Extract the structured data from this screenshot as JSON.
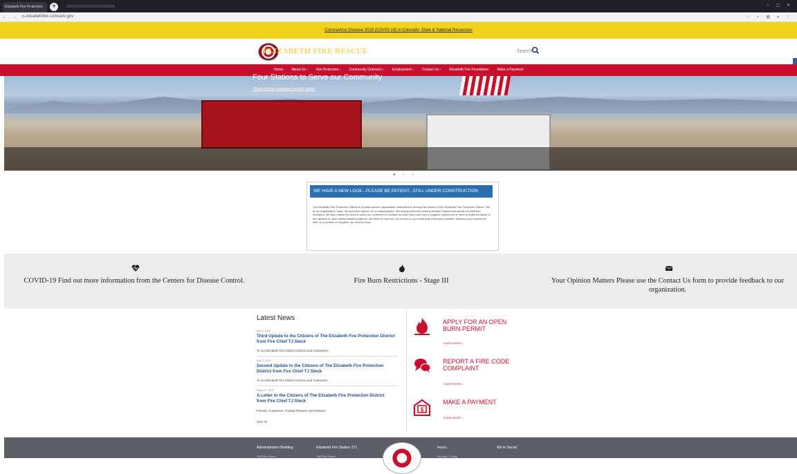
{
  "browser": {
    "tab_title": "Elizabeth Fire Protection",
    "url": "elizabethfire.colorado.gov"
  },
  "banner": {
    "text": "Coronavirus Disease 2019 (COVID-19) in Colorado: State & National Resources"
  },
  "header": {
    "search_label": "Search"
  },
  "nav": {
    "items": [
      {
        "label": "Home"
      },
      {
        "label": "About Us"
      },
      {
        "label": "Fire Protection"
      },
      {
        "label": "Community Outreach"
      },
      {
        "label": "Employment"
      },
      {
        "label": "Contact Us"
      },
      {
        "label": "Elizabeth Fire Foundation"
      },
      {
        "label": "Make a Payment"
      }
    ],
    "separator": "›"
  },
  "hero": {
    "truck_text": "ELIZABETH FIRE RESCUE",
    "title": "Four Stations to Serve our Community",
    "subtitle": "Check out the equipment at each station"
  },
  "notice": {
    "heading": "WE HAVE A NEW LOOK...PLEASE BE PATIENT...STILL UNDER CONSTRUCTION",
    "body": "The Elizabeth Fire Protection District is a public service organization dedicated to serving the citizens of the Elizabeth Fire Protection District. We, as an organization, value the input and opinion of our stakeholders. We always welcome hearing positive experiences about our staff and members. We also realize the need to allow our customers to contact us when they have had a negative experience or need to make us aware of fire hazards or other safety-related problems. We strive to improve our service to our community whenever possible. Whether your experience with us is positive or negative, we want to know."
  },
  "features": [
    {
      "icon": "heartbeat-icon",
      "text": "COVID-19 Find out more information from the Centers for Disease Control."
    },
    {
      "icon": "fire-icon",
      "text": "Fire Burn Restrictions - Stage III"
    },
    {
      "icon": "envelope-icon",
      "text": "Your Opinion Matters Please use the Contact Us form to provide feedback to our organization."
    }
  ],
  "news": {
    "title": "Latest News",
    "items": [
      {
        "date": "April 9, 2020",
        "headline": "Third Update to the Citizens of The Elizabeth Fire Protection District from Fire Chief TJ Steck",
        "excerpt": "To our Elizabeth Fire District Citizens and Customers,"
      },
      {
        "date": "April 3, 2020",
        "headline": "Second Update to the Citizens of The Elizabeth Fire Protection District from Fire Chief TJ Steck",
        "excerpt": "To our Elizabeth Fire District Citizens and Customers,"
      },
      {
        "date": "March 27, 2020",
        "headline": "A Letter to the Citizens of The Elizabeth Fire Protection District from Fire Chief TJ Steck",
        "excerpt": "Friends, Customers, Trusted Partners and Partners,"
      }
    ],
    "view_all": "View All"
  },
  "actions": [
    {
      "icon": "fire-icon",
      "title": "APPLY FOR AN OPEN BURN PERMIT",
      "more": "LEARN MORE »"
    },
    {
      "icon": "speech-bubble-icon",
      "title": "REPORT A FIRE CODE COMPLAINT",
      "more": "LEARN MORE »"
    },
    {
      "icon": "payment-icon",
      "title": "MAKE A PAYMENT",
      "more": "LEARN MORE »"
    }
  ],
  "footer": {
    "col1": "Administration Building",
    "col1_sub": "155 Pine Street",
    "col2": "Elizabeth Fire Station 271",
    "col2_sub": "155 Pine Street",
    "col3": "Hours",
    "col3_sub": "Monday - Friday",
    "col4": "We're Social"
  },
  "colors": {
    "brand_red": "#c8102e",
    "banner_yellow": "#f2d11b",
    "notice_blue": "#2c6fb0",
    "footer_gray": "#5a5f66"
  }
}
